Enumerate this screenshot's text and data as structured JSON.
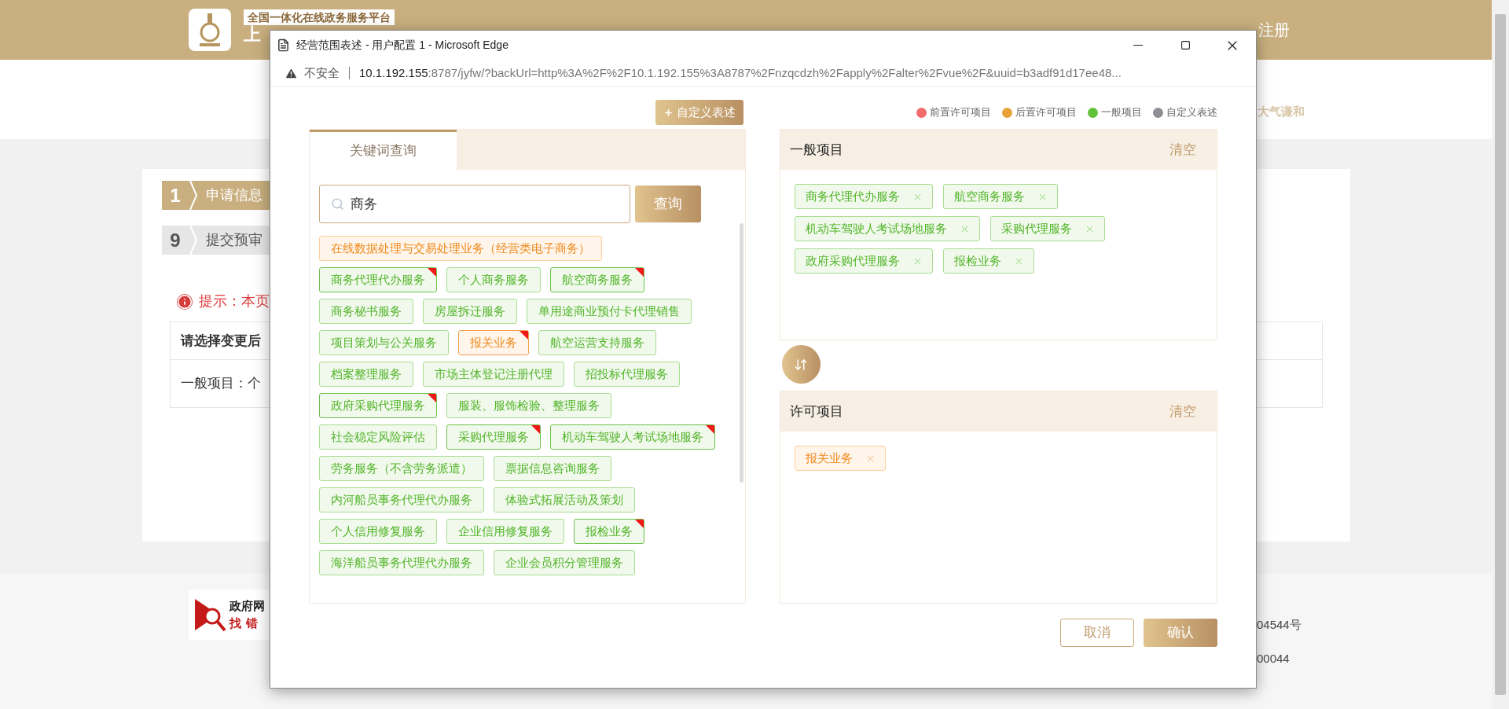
{
  "page": {
    "header": {
      "badge": "全国一体化在线政务服务平台",
      "logo_text": "上",
      "register": "注册"
    },
    "motto": "大气谦和",
    "steps": [
      {
        "number": "1",
        "label": "申请信息",
        "selected": true
      },
      {
        "number": "9",
        "label": "提交预审",
        "selected": false
      }
    ],
    "tip": "提示：本页",
    "table": {
      "header": "请选择变更后",
      "row": "一般项目：个"
    },
    "footer": {
      "badge_top": "政府网",
      "badge_bottom": "找错",
      "record_1": "04544号",
      "record_2": "00044"
    }
  },
  "window": {
    "title": "经营范围表述 - 用户配置 1 - Microsoft Edge",
    "security": "不安全",
    "url_host": "10.1.192.155",
    "url_rest": ":8787/jyfw/?backUrl=http%3A%2F%2F10.1.192.155%3A8787%2Fnzqcdzh%2Fapply%2Falter%2Fvue%2F&uuid=b3adf91d17ee48..."
  },
  "dialog": {
    "custom_button": "自定义表述",
    "legend": [
      {
        "label": "前置许可项目",
        "color": "#f06b6b"
      },
      {
        "label": "后置许可项目",
        "color": "#e8a23a"
      },
      {
        "label": "一般项目",
        "color": "#62c13a"
      },
      {
        "label": "自定义表述",
        "color": "#8e8e96"
      }
    ],
    "tabs": [
      {
        "label": "关键词查询",
        "selected": true
      }
    ],
    "search": {
      "value": "商务"
    },
    "search_button": "查询",
    "results": [
      {
        "label": "在线数据处理与交易处理业务（经营类电子商务）",
        "kind": "permit",
        "selected": false
      },
      {
        "label": "商务代理代办服务",
        "kind": "general",
        "selected": true
      },
      {
        "label": "个人商务服务",
        "kind": "general",
        "selected": false
      },
      {
        "label": "航空商务服务",
        "kind": "general",
        "selected": true
      },
      {
        "label": "商务秘书服务",
        "kind": "general",
        "selected": false
      },
      {
        "label": "房屋拆迁服务",
        "kind": "general",
        "selected": false
      },
      {
        "label": "单用途商业预付卡代理销售",
        "kind": "general",
        "selected": false
      },
      {
        "label": "项目策划与公关服务",
        "kind": "general",
        "selected": false
      },
      {
        "label": "报关业务",
        "kind": "permit",
        "selected": true
      },
      {
        "label": "航空运营支持服务",
        "kind": "general",
        "selected": false
      },
      {
        "label": "档案整理服务",
        "kind": "general",
        "selected": false
      },
      {
        "label": "市场主体登记注册代理",
        "kind": "general",
        "selected": false
      },
      {
        "label": "招投标代理服务",
        "kind": "general",
        "selected": false
      },
      {
        "label": "政府采购代理服务",
        "kind": "general",
        "selected": true
      },
      {
        "label": "服装、服饰检验、整理服务",
        "kind": "general",
        "selected": false
      },
      {
        "label": "社会稳定风险评估",
        "kind": "general",
        "selected": false
      },
      {
        "label": "采购代理服务",
        "kind": "general",
        "selected": true
      },
      {
        "label": "机动车驾驶人考试场地服务",
        "kind": "general",
        "selected": true
      },
      {
        "label": "劳务服务（不含劳务派遣）",
        "kind": "general",
        "selected": false
      },
      {
        "label": "票据信息咨询服务",
        "kind": "general",
        "selected": false
      },
      {
        "label": "内河船员事务代理代办服务",
        "kind": "general",
        "selected": false
      },
      {
        "label": "体验式拓展活动及策划",
        "kind": "general",
        "selected": false
      },
      {
        "label": "个人信用修复服务",
        "kind": "general",
        "selected": false
      },
      {
        "label": "企业信用修复服务",
        "kind": "general",
        "selected": false
      },
      {
        "label": "报检业务",
        "kind": "general",
        "selected": true
      },
      {
        "label": "海洋船员事务代理代办服务",
        "kind": "general",
        "selected": false
      },
      {
        "label": "企业会员积分管理服务",
        "kind": "general",
        "selected": false
      }
    ],
    "general": {
      "title": "一般项目",
      "clear": "清空",
      "items": [
        {
          "label": "商务代理代办服务",
          "kind": "general"
        },
        {
          "label": "航空商务服务",
          "kind": "general"
        },
        {
          "label": "机动车驾驶人考试场地服务",
          "kind": "general"
        },
        {
          "label": "采购代理服务",
          "kind": "general"
        },
        {
          "label": "政府采购代理服务",
          "kind": "general"
        },
        {
          "label": "报检业务",
          "kind": "general"
        }
      ]
    },
    "permit": {
      "title": "许可项目",
      "clear": "清空",
      "items": [
        {
          "label": "报关业务",
          "kind": "permit"
        }
      ]
    },
    "cancel": "取消",
    "confirm": "确认"
  }
}
